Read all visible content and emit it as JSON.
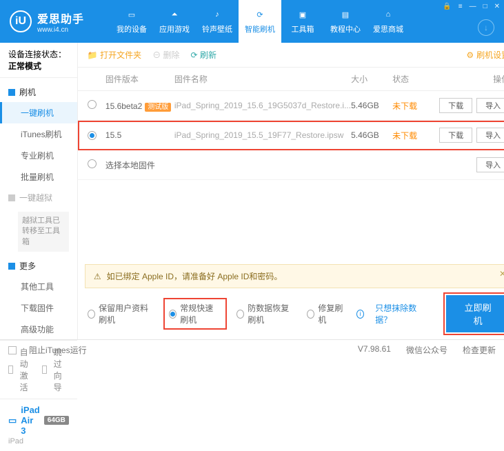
{
  "app": {
    "name_cn": "爱思助手",
    "url": "www.i4.cn"
  },
  "nav": [
    {
      "label": "我的设备"
    },
    {
      "label": "应用游戏"
    },
    {
      "label": "铃声壁纸"
    },
    {
      "label": "智能刷机"
    },
    {
      "label": "工具箱"
    },
    {
      "label": "教程中心"
    },
    {
      "label": "爱思商城"
    }
  ],
  "sidebar": {
    "conn_label": "设备连接状态：",
    "conn_value": "正常模式",
    "group_flash": "刷机",
    "items_flash": [
      "一键刷机",
      "iTunes刷机",
      "专业刷机",
      "批量刷机"
    ],
    "group_jail": "一键越狱",
    "jail_note": "越狱工具已转移至工具箱",
    "group_more": "更多",
    "items_more": [
      "其他工具",
      "下载固件",
      "高级功能"
    ],
    "auto_activate": "自动激活",
    "skip_guide": "跳过向导"
  },
  "device": {
    "name": "iPad Air 3",
    "badge": "64GB",
    "sub": "iPad"
  },
  "toolbar": {
    "open_folder": "打开文件夹",
    "delete": "删除",
    "refresh": "刷新",
    "settings": "刷机设置"
  },
  "table": {
    "head": {
      "ver": "固件版本",
      "name": "固件名称",
      "size": "大小",
      "status": "状态",
      "ops": "操作"
    },
    "btn_download": "下载",
    "btn_import": "导入",
    "rows": [
      {
        "ver": "15.6beta2",
        "beta": "测试版",
        "name": "iPad_Spring_2019_15.6_19G5037d_Restore.i...",
        "size": "5.46GB",
        "status": "未下载",
        "selected": false
      },
      {
        "ver": "15.5",
        "beta": "",
        "name": "iPad_Spring_2019_15.5_19F77_Restore.ipsw",
        "size": "5.46GB",
        "status": "未下载",
        "selected": true
      }
    ],
    "local_row": "选择本地固件"
  },
  "alert": "如已绑定 Apple ID，请准备好 Apple ID和密码。",
  "flash_opts": {
    "keep_data": "保留用户资料刷机",
    "normal": "常规快速刷机",
    "anti_recovery": "防数据恢复刷机",
    "repair": "修复刷机",
    "erase_link": "只想抹除数据？",
    "go": "立即刷机"
  },
  "statusbar": {
    "block_itunes": "阻止iTunes运行",
    "version": "V7.98.61",
    "wechat": "微信公众号",
    "check_update": "检查更新"
  }
}
